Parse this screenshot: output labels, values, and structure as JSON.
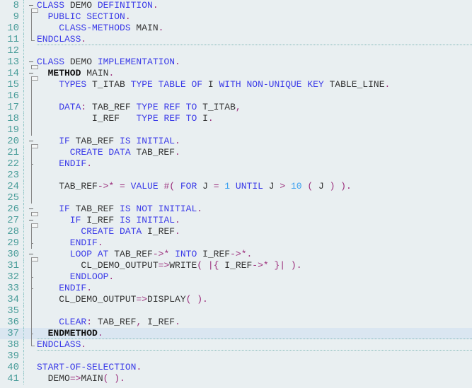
{
  "colors": {
    "keyword": "#3a3ae8",
    "identifier": "#333333",
    "punctuation": "#9a2b7a",
    "number": "#3aa0f0",
    "background": "#e9eff1",
    "current_line": "#dae6f1",
    "line_number": "#4a9d9a"
  },
  "lines": [
    {
      "n": "8",
      "fold": "box",
      "tokens": [
        [
          "kw",
          "CLASS"
        ],
        [
          "id",
          " DEMO "
        ],
        [
          "kw",
          "DEFINITION"
        ],
        [
          "p",
          "."
        ]
      ]
    },
    {
      "n": "9",
      "fold": "bar",
      "tokens": [
        [
          "kw",
          "  PUBLIC SECTION"
        ],
        [
          "p",
          "."
        ]
      ]
    },
    {
      "n": "10",
      "fold": "bar",
      "tokens": [
        [
          "kw",
          "    CLASS-METHODS"
        ],
        [
          "id",
          " MAIN"
        ],
        [
          "p",
          "."
        ]
      ]
    },
    {
      "n": "11",
      "fold": "end",
      "sep": true,
      "tokens": [
        [
          "kw",
          "ENDCLASS"
        ],
        [
          "p",
          "."
        ]
      ]
    },
    {
      "n": "12",
      "fold": "",
      "tokens": []
    },
    {
      "n": "13",
      "fold": "box",
      "tokens": [
        [
          "kw",
          "CLASS"
        ],
        [
          "id",
          " DEMO "
        ],
        [
          "kw",
          "IMPLEMENTATION"
        ],
        [
          "p",
          "."
        ]
      ]
    },
    {
      "n": "14",
      "fold": "box",
      "tokens": [
        [
          "b",
          "  METHOD"
        ],
        [
          "id",
          " MAIN"
        ],
        [
          "p",
          "."
        ]
      ]
    },
    {
      "n": "15",
      "fold": "bar",
      "tokens": [
        [
          "kw",
          "    TYPES"
        ],
        [
          "id",
          " T_ITAB "
        ],
        [
          "kw",
          "TYPE TABLE OF"
        ],
        [
          "id",
          " I "
        ],
        [
          "kw",
          "WITH NON-UNIQUE KEY"
        ],
        [
          "id",
          " TABLE_LINE"
        ],
        [
          "p",
          "."
        ]
      ]
    },
    {
      "n": "16",
      "fold": "bar",
      "tokens": []
    },
    {
      "n": "17",
      "fold": "bar",
      "tokens": [
        [
          "kw",
          "    DATA"
        ],
        [
          "p",
          ":"
        ],
        [
          "id",
          " TAB_REF "
        ],
        [
          "kw",
          "TYPE REF TO"
        ],
        [
          "id",
          " T_ITAB"
        ],
        [
          "p",
          ","
        ]
      ]
    },
    {
      "n": "18",
      "fold": "bar",
      "tokens": [
        [
          "id",
          "          I_REF   "
        ],
        [
          "kw",
          "TYPE REF TO"
        ],
        [
          "id",
          " I"
        ],
        [
          "p",
          "."
        ]
      ]
    },
    {
      "n": "19",
      "fold": "bar",
      "tokens": []
    },
    {
      "n": "20",
      "fold": "box",
      "tokens": [
        [
          "kw",
          "    IF"
        ],
        [
          "id",
          " TAB_REF "
        ],
        [
          "kw",
          "IS INITIAL"
        ],
        [
          "p",
          "."
        ]
      ]
    },
    {
      "n": "21",
      "fold": "bar",
      "tokens": [
        [
          "kw",
          "      CREATE DATA"
        ],
        [
          "id",
          " TAB_REF"
        ],
        [
          "p",
          "."
        ]
      ]
    },
    {
      "n": "22",
      "fold": "tick",
      "tokens": [
        [
          "kw",
          "    ENDIF"
        ],
        [
          "p",
          "."
        ]
      ]
    },
    {
      "n": "23",
      "fold": "bar",
      "tokens": []
    },
    {
      "n": "24",
      "fold": "bar",
      "tokens": [
        [
          "id",
          "    TAB_REF"
        ],
        [
          "p",
          "->* = "
        ],
        [
          "kw",
          "VALUE"
        ],
        [
          "p",
          " #( "
        ],
        [
          "kw",
          "FOR"
        ],
        [
          "id",
          " J "
        ],
        [
          "p",
          "= "
        ],
        [
          "num",
          "1"
        ],
        [
          "kw",
          " UNTIL"
        ],
        [
          "id",
          " J "
        ],
        [
          "p",
          "> "
        ],
        [
          "num",
          "10"
        ],
        [
          "p",
          " ( "
        ],
        [
          "id",
          "J"
        ],
        [
          "p",
          " ) )."
        ]
      ]
    },
    {
      "n": "25",
      "fold": "bar",
      "tokens": []
    },
    {
      "n": "26",
      "fold": "box",
      "tokens": [
        [
          "kw",
          "    IF"
        ],
        [
          "id",
          " TAB_REF "
        ],
        [
          "kw",
          "IS NOT INITIAL"
        ],
        [
          "p",
          "."
        ]
      ]
    },
    {
      "n": "27",
      "fold": "box",
      "tokens": [
        [
          "kw",
          "      IF"
        ],
        [
          "id",
          " I_REF "
        ],
        [
          "kw",
          "IS INITIAL"
        ],
        [
          "p",
          "."
        ]
      ]
    },
    {
      "n": "28",
      "fold": "bar",
      "tokens": [
        [
          "kw",
          "        CREATE DATA"
        ],
        [
          "id",
          " I_REF"
        ],
        [
          "p",
          "."
        ]
      ]
    },
    {
      "n": "29",
      "fold": "tick",
      "tokens": [
        [
          "kw",
          "      ENDIF"
        ],
        [
          "p",
          "."
        ]
      ]
    },
    {
      "n": "30",
      "fold": "box",
      "tokens": [
        [
          "kw",
          "      LOOP AT"
        ],
        [
          "id",
          " TAB_REF"
        ],
        [
          "p",
          "->* "
        ],
        [
          "kw",
          "INTO"
        ],
        [
          "id",
          " I_REF"
        ],
        [
          "p",
          "->*."
        ]
      ]
    },
    {
      "n": "31",
      "fold": "bar",
      "tokens": [
        [
          "id",
          "        CL_DEMO_OUTPUT"
        ],
        [
          "p",
          "=>"
        ],
        [
          "id",
          "WRITE"
        ],
        [
          "p",
          "( |{ "
        ],
        [
          "id",
          "I_REF"
        ],
        [
          "p",
          "->* }| )."
        ]
      ]
    },
    {
      "n": "32",
      "fold": "tick",
      "tokens": [
        [
          "kw",
          "      ENDLOOP"
        ],
        [
          "p",
          "."
        ]
      ]
    },
    {
      "n": "33",
      "fold": "tick",
      "tokens": [
        [
          "kw",
          "    ENDIF"
        ],
        [
          "p",
          "."
        ]
      ]
    },
    {
      "n": "34",
      "fold": "bar",
      "tokens": [
        [
          "id",
          "    CL_DEMO_OUTPUT"
        ],
        [
          "p",
          "=>"
        ],
        [
          "id",
          "DISPLAY"
        ],
        [
          "p",
          "( )."
        ]
      ]
    },
    {
      "n": "35",
      "fold": "bar",
      "tokens": []
    },
    {
      "n": "36",
      "fold": "bar",
      "tokens": [
        [
          "kw",
          "    CLEAR"
        ],
        [
          "p",
          ":"
        ],
        [
          "id",
          " TAB_REF"
        ],
        [
          "p",
          ","
        ],
        [
          "id",
          " I_REF"
        ],
        [
          "p",
          "."
        ]
      ]
    },
    {
      "n": "37",
      "fold": "tick",
      "hl": true,
      "sep": true,
      "tokens": [
        [
          "b",
          "  ENDMETHOD"
        ],
        [
          "p",
          "."
        ]
      ]
    },
    {
      "n": "38",
      "fold": "end",
      "sep": true,
      "tokens": [
        [
          "kw",
          "ENDCLASS"
        ],
        [
          "p",
          "."
        ]
      ]
    },
    {
      "n": "39",
      "fold": "",
      "tokens": []
    },
    {
      "n": "40",
      "fold": "",
      "tokens": [
        [
          "kw",
          "START-OF-SELECTION"
        ],
        [
          "p",
          "."
        ]
      ]
    },
    {
      "n": "41",
      "fold": "",
      "tokens": [
        [
          "id",
          "  DEMO"
        ],
        [
          "p",
          "=>"
        ],
        [
          "id",
          "MAIN"
        ],
        [
          "p",
          "( )."
        ]
      ]
    }
  ]
}
